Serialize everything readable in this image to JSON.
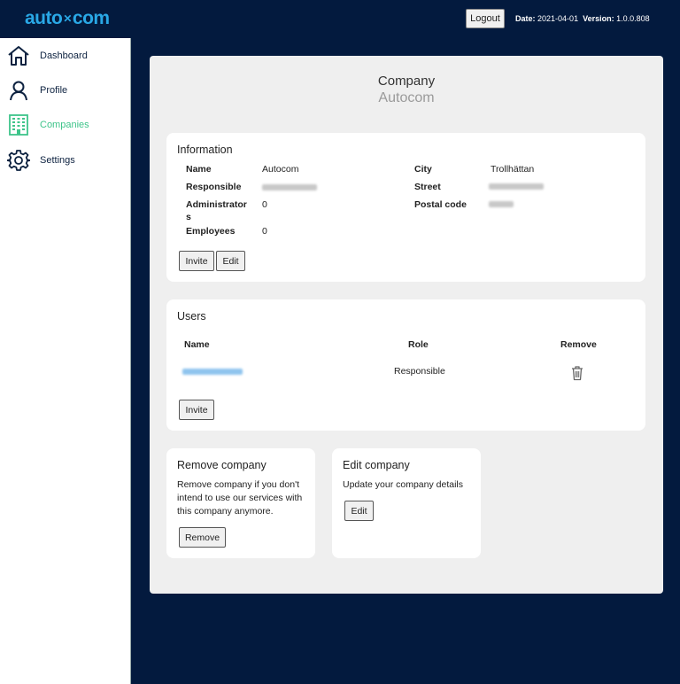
{
  "header": {
    "logo_left": "auto",
    "logo_sep": "✕",
    "logo_right": "com",
    "logout_label": "Logout",
    "date_label": "Date:",
    "date_value": "2021-04-01",
    "version_label": "Version:",
    "version_value": "1.0.0.808"
  },
  "sidebar": {
    "items": [
      {
        "label": "Dashboard",
        "icon": "home-icon"
      },
      {
        "label": "Profile",
        "icon": "user-icon"
      },
      {
        "label": "Companies",
        "icon": "building-icon",
        "active": true
      },
      {
        "label": "Settings",
        "icon": "gear-icon"
      }
    ]
  },
  "colors": {
    "navy": "#031a3e",
    "accent_green": "#3ec48a",
    "logo_blue": "#29a8e6"
  },
  "company": {
    "title": "Company",
    "name": "Autocom",
    "information": {
      "title": "Information",
      "name_label": "Name",
      "name_value": "Autocom",
      "responsible_label": "Responsible",
      "administrators_label_1": "Administrator",
      "administrators_label_2": "s",
      "administrators_value": "0",
      "employees_label": "Employees",
      "employees_value": "0",
      "city_label": "City",
      "city_value": "Trollhättan",
      "street_label": "Street",
      "postal_label": "Postal code",
      "invite_label": "Invite",
      "edit_label": "Edit"
    },
    "users": {
      "title": "Users",
      "col_name": "Name",
      "col_role": "Role",
      "col_remove": "Remove",
      "rows": [
        {
          "role": "Responsible"
        }
      ],
      "invite_label": "Invite"
    },
    "remove_company": {
      "title": "Remove company",
      "line1": "Remove company if you don't",
      "line2": "intend to use our services with",
      "line3": "this company anymore.",
      "button": "Remove"
    },
    "edit_company": {
      "title": "Edit company",
      "desc": "Update your company details",
      "button": "Edit"
    }
  }
}
